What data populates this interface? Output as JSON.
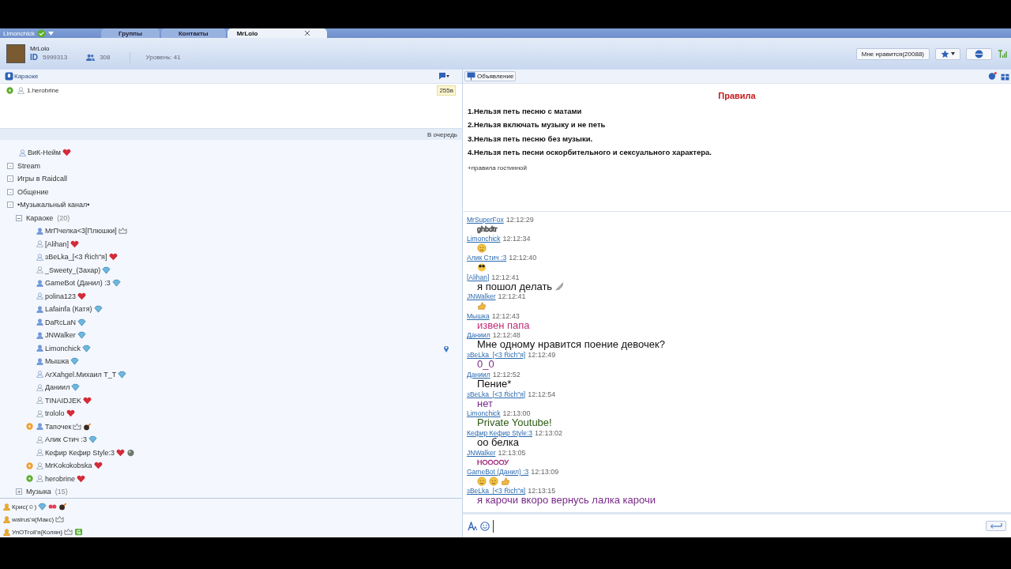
{
  "account": {
    "name": "Limonchick"
  },
  "tabs": [
    {
      "label": "Группы",
      "selected": false
    },
    {
      "label": "Контакты",
      "selected": false
    },
    {
      "label": "MrLolo",
      "selected": true,
      "closable": true
    }
  ],
  "profile": {
    "name": "MrLolo",
    "id_label": "ID",
    "id": "5999313",
    "members": "308",
    "level": "Уровень: 41",
    "like_button": "Мне нравится(20088)"
  },
  "channel": {
    "name": "Караоке",
    "queue": [
      {
        "name": "1.herobrine",
        "mic": {
          "color": "#5fae2e"
        },
        "timer": "255в"
      }
    ],
    "queue_button": "В очередь"
  },
  "tree": [
    {
      "kind": "hollow",
      "name": "ВиК-Нейм",
      "badges": [
        {
          "kind": "heart"
        }
      ]
    },
    {
      "kind": "group",
      "toggle": "·",
      "name": "Stream"
    },
    {
      "kind": "group",
      "toggle": "·",
      "name": "Игры в Raidcall"
    },
    {
      "kind": "group",
      "toggle": "·",
      "name": "Общение"
    },
    {
      "kind": "group",
      "toggle": "·",
      "name": "•Музыкальный канал•",
      "children": [
        {
          "kind": "group",
          "toggle": "−",
          "name": "Караоке",
          "count": "(20)",
          "children": [
            {
              "kind": "solid",
              "name": "MrПчелка<3[Плюшки]",
              "badges": [
                {
                  "kind": "crown"
                }
              ]
            },
            {
              "kind": "outline",
              "name": "[Alihan]",
              "badges": [
                {
                  "kind": "heart"
                }
              ]
            },
            {
              "kind": "hollow",
              "name": "ɜBeLka_[<3 Ŕich\"я]",
              "badges": [
                {
                  "kind": "heart"
                }
              ]
            },
            {
              "kind": "outline",
              "name": "_Sweety_(Захар)",
              "badges": [
                {
                  "kind": "gem"
                }
              ]
            },
            {
              "kind": "solid",
              "name": "GameBot (Данил) :3",
              "badges": [
                {
                  "kind": "gem"
                }
              ]
            },
            {
              "kind": "hollow",
              "name": "polina123",
              "badges": [
                {
                  "kind": "heart"
                }
              ]
            },
            {
              "kind": "solid",
              "name": "Lafainfa (Катя)",
              "badges": [
                {
                  "kind": "gem"
                }
              ]
            },
            {
              "kind": "solid",
              "name": "DaRcLaN",
              "badges": [
                {
                  "kind": "gem"
                }
              ]
            },
            {
              "kind": "solid",
              "name": "JNWalker",
              "badges": [
                {
                  "kind": "gem"
                }
              ]
            },
            {
              "kind": "solid",
              "name": "Limonchick",
              "badges": [
                {
                  "kind": "gem"
                }
              ],
              "pinned": true
            },
            {
              "kind": "solid",
              "name": "Мышка",
              "badges": [
                {
                  "kind": "gem"
                }
              ]
            },
            {
              "kind": "hollow",
              "name": "ArXahgel.Михаил T_T",
              "badges": [
                {
                  "kind": "gem"
                }
              ]
            },
            {
              "kind": "outline",
              "name": "Даниил",
              "badges": [
                {
                  "kind": "gem"
                }
              ]
            },
            {
              "kind": "outline",
              "name": "TINAIDJEK",
              "badges": [
                {
                  "kind": "heart"
                }
              ]
            },
            {
              "kind": "outline",
              "name": "trololo",
              "badges": [
                {
                  "kind": "heart"
                }
              ]
            },
            {
              "kind": "solid",
              "name": "Тапочек",
              "mic": {
                "color": "#f0a030"
              },
              "badges": [
                {
                  "kind": "crown"
                },
                {
                  "kind": "bomb"
                }
              ]
            },
            {
              "kind": "outline",
              "name": "Алик Стич :3",
              "badges": [
                {
                  "kind": "gem"
                }
              ]
            },
            {
              "kind": "outline",
              "name": "Кефир Кефир Style:3",
              "badges": [
                {
                  "kind": "heart"
                },
                {
                  "kind": "ball"
                }
              ]
            },
            {
              "kind": "outline",
              "name": "MrKokokobska",
              "mic": {
                "color": "#f0a030"
              },
              "badges": [
                {
                  "kind": "heart"
                }
              ]
            },
            {
              "kind": "outline",
              "name": "herobrine",
              "mic": {
                "color": "#5fae2e"
              },
              "badges": [
                {
                  "kind": "heart"
                }
              ]
            }
          ]
        },
        {
          "kind": "group",
          "toggle": "+",
          "name": "Музыка",
          "count": "(15)"
        }
      ]
    }
  ],
  "guests": [
    {
      "name": "Крис(☺)",
      "badges": [
        {
          "kind": "gem"
        },
        {
          "kind": "glasses"
        },
        {
          "kind": "bomb"
        }
      ]
    },
    {
      "name": "walrus'я(Макс)",
      "badges": [
        {
          "kind": "crown"
        }
      ]
    },
    {
      "name": "УпОTroll'я{Колян}",
      "badges": [
        {
          "kind": "crown"
        },
        {
          "kind": "square"
        }
      ]
    }
  ],
  "announcement": {
    "button": "Объявление",
    "title": "Правила",
    "rules": [
      "1.Нельзя петь песню с матами",
      "2.Нельзя включать музыку и не петь",
      "3.Нельзя петь песню без музыки.",
      "4.Нельзя петь песни оскорбительного и сексуального характера."
    ],
    "note": "+правила гостинной"
  },
  "chat": [
    {
      "author": "MrSuperFox",
      "time": "12:12:29",
      "text": "ghbdtr",
      "kind": "small",
      "color": "#222222"
    },
    {
      "author": "Limonchick",
      "time": "12:12:34",
      "emojis": [
        {
          "kind": "wink"
        }
      ]
    },
    {
      "author": "Алик Стич :3",
      "time": "12:12:40",
      "emojis": [
        {
          "kind": "glasses"
        }
      ]
    },
    {
      "author": "[Alihan]",
      "time": "12:12:41",
      "text": "я пошол делать",
      "kind": "large",
      "color": "#111111",
      "emojis": [
        {
          "kind": "knife"
        }
      ]
    },
    {
      "author": "JNWalker",
      "time": "12:12:41",
      "emojis": [
        {
          "kind": "thumb"
        }
      ]
    },
    {
      "author": "Мышка",
      "time": "12:12:43",
      "text": "извен папа",
      "kind": "large",
      "color": "#c0307a"
    },
    {
      "author": "Даниил",
      "time": "12:12:48",
      "text": "Мне одному нравится поение девочек?",
      "kind": "large",
      "color": "#111111"
    },
    {
      "author": "ɜBeLka_[<3 Ŕich\"я]",
      "time": "12:12:49",
      "text": "0_0",
      "kind": "large",
      "color": "#7a2a8a"
    },
    {
      "author": "Даниил",
      "time": "12:12:52",
      "text": "Пение*",
      "kind": "large",
      "color": "#111111"
    },
    {
      "author": "ɜBeLka_[<3 Ŕich\"я]",
      "time": "12:12:54",
      "text": "нет",
      "kind": "large",
      "color": "#7a2a8a"
    },
    {
      "author": "Limonchick",
      "time": "12:13:00",
      "text": "Private Youtube!",
      "kind": "large",
      "color": "#2d5a16"
    },
    {
      "author": "Кефир Кефир Style:3",
      "time": "12:13:02",
      "text": "оо белка",
      "kind": "large",
      "color": "#111111"
    },
    {
      "author": "JNWalker",
      "time": "12:13:05",
      "text": "НООООУ",
      "kind": "small",
      "color": "#a02a7a"
    },
    {
      "author": "GameBot (Данил) :3",
      "time": "12:13:09",
      "emojis": [
        {
          "kind": "wink"
        },
        {
          "kind": "wink"
        },
        {
          "kind": "thumb"
        }
      ]
    },
    {
      "author": "ɜBeLka_[<3 Ŕich\"я]",
      "time": "12:13:15",
      "text": "я карочи вкоро вернусь лалка карочи",
      "kind": "large",
      "color": "#7a2a8a"
    }
  ]
}
